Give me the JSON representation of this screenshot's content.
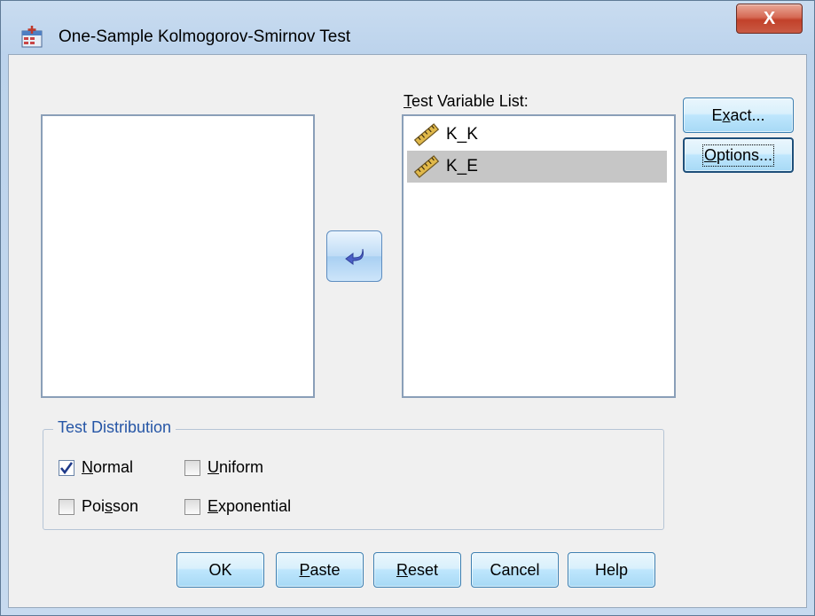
{
  "window": {
    "title": "One-Sample Kolmogorov-Smirnov Test",
    "close_glyph": "X"
  },
  "source_list": {
    "items": []
  },
  "target_list": {
    "label_prefix": "T",
    "label_rest": "est Variable List:",
    "items": [
      {
        "label": "K_K",
        "icon": "scale-ruler-icon",
        "selected": false
      },
      {
        "label": "K_E",
        "icon": "scale-ruler-icon",
        "selected": true
      }
    ]
  },
  "side_buttons": {
    "exact_pre": "E",
    "exact_ul": "x",
    "exact_post": "act...",
    "options_ul": "O",
    "options_post": "ptions..."
  },
  "move_button": {
    "icon": "move-arrow-icon"
  },
  "test_distribution": {
    "title": "Test Distribution",
    "normal": {
      "ul": "N",
      "rest": "ormal",
      "checked": true
    },
    "uniform": {
      "ul": "U",
      "rest": "niform",
      "checked": false
    },
    "poisson": {
      "pre": "Poi",
      "ul": "s",
      "post": "son",
      "checked": false
    },
    "exponential": {
      "ul": "E",
      "rest": "xponential",
      "checked": false
    }
  },
  "bottom_buttons": {
    "ok": "OK",
    "paste_ul": "P",
    "paste_rest": "aste",
    "reset_ul": "R",
    "reset_rest": "eset",
    "cancel": "Cancel",
    "help": "Help"
  },
  "colors": {
    "accent": "#2656a6",
    "selection": "#c6c6c6",
    "button_border": "#3c7fb1",
    "close_button": "#c2412a"
  }
}
